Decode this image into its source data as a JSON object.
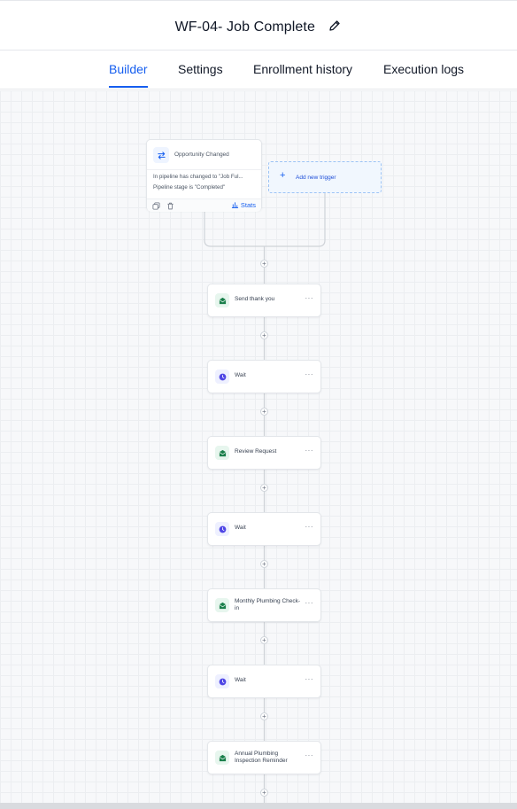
{
  "header": {
    "title": "WF-04- Job Complete",
    "edit_icon": "pencil-icon"
  },
  "tabs": [
    {
      "label": "Builder",
      "active": true
    },
    {
      "label": "Settings",
      "active": false
    },
    {
      "label": "Enrollment history",
      "active": false
    },
    {
      "label": "Execution logs",
      "active": false
    }
  ],
  "trigger": {
    "icon": "swap-arrows-icon",
    "title": "Opportunity Changed",
    "line1": "In pipeline has changed to \"Job Ful...",
    "line2": "Pipeline stage is \"Completed\"",
    "stats_label": "Stats"
  },
  "add_trigger": {
    "label": "Add new trigger"
  },
  "actions": [
    {
      "type": "email",
      "label": "Send thank you"
    },
    {
      "type": "wait",
      "label": "Wait"
    },
    {
      "type": "email",
      "label": "Review Request"
    },
    {
      "type": "wait",
      "label": "Wait"
    },
    {
      "type": "email",
      "label": "Monthly Plumbing Check-in"
    },
    {
      "type": "wait",
      "label": "Wait"
    },
    {
      "type": "email",
      "label": "Annual Plumbing Inspection Reminder"
    }
  ],
  "menu_glyph": "···",
  "plus_glyph": "+",
  "colors": {
    "accent": "#155eef",
    "email_icon": "#1a7f4b",
    "wait_icon": "#4f46e5"
  }
}
